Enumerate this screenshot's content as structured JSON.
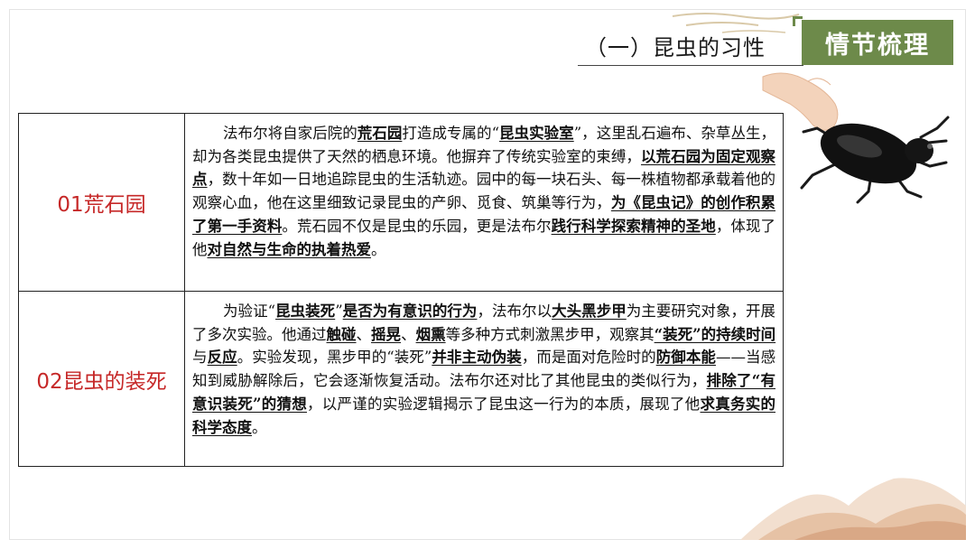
{
  "header": {
    "section_title": "（一）昆虫的习性",
    "badge": "情节梳理"
  },
  "rows": [
    {
      "label": "01荒石园",
      "segments": [
        {
          "t": "法布尔将自家后院的",
          "u": false
        },
        {
          "t": "荒石园",
          "u": true
        },
        {
          "t": "打造成专属的“",
          "u": false
        },
        {
          "t": "昆虫实验室",
          "u": true
        },
        {
          "t": "”，这里乱石遍布、杂草丛生，却为各类昆虫提供了天然的栖息环境。他摒弃了传统实验室的束缚，",
          "u": false
        },
        {
          "t": "以荒石园为固定观察点",
          "u": true
        },
        {
          "t": "，数十年如一日地追踪昆虫的生活轨迹。园中的每一块石头、每一株植物都承载着他的观察心血，他在这里细致记录昆虫的产卵、觅食、筑巢等行为，",
          "u": false
        },
        {
          "t": "为《昆虫记》的创作积累了第一手资料",
          "u": true
        },
        {
          "t": "。荒石园不仅是昆虫的乐园，更是法布尔",
          "u": false
        },
        {
          "t": "践行科学探索精神的圣地",
          "u": true
        },
        {
          "t": "，体现了他",
          "u": false
        },
        {
          "t": "对自然与生命的执着热爱",
          "u": true
        },
        {
          "t": "。",
          "u": false
        }
      ]
    },
    {
      "label": "02昆虫的装死",
      "segments": [
        {
          "t": "为验证“",
          "u": false
        },
        {
          "t": "昆虫装死",
          "u": true
        },
        {
          "t": "”",
          "u": false
        },
        {
          "t": "是否为有意识的行为",
          "u": true
        },
        {
          "t": "，法布尔以",
          "u": false
        },
        {
          "t": "大头黑步甲",
          "u": true
        },
        {
          "t": "为主要研究对象，开展了多次实验。他通过",
          "u": false
        },
        {
          "t": "触碰",
          "u": true
        },
        {
          "t": "、",
          "u": false
        },
        {
          "t": "摇晃",
          "u": true
        },
        {
          "t": "、",
          "u": false
        },
        {
          "t": "烟熏",
          "u": true
        },
        {
          "t": "等多种方式刺激黑步甲，观察其",
          "u": false
        },
        {
          "t": "“装死”的持续时间",
          "u": true
        },
        {
          "t": "与",
          "u": false
        },
        {
          "t": "反应",
          "u": true
        },
        {
          "t": "。实验发现，黑步甲的“装死”",
          "u": false
        },
        {
          "t": "并非主动伪装",
          "u": true
        },
        {
          "t": "，而是面对危险时的",
          "u": false
        },
        {
          "t": "防御本能",
          "u": true
        },
        {
          "t": "——当感知到威胁解除后，它会逐渐恢复活动。法布尔还对比了其他昆虫的类似行为，",
          "u": false
        },
        {
          "t": "排除了“有意识装死”的猜想",
          "u": true
        },
        {
          "t": "，以严谨的实验逻辑揭示了昆虫这一行为的本质，展现了他",
          "u": false
        },
        {
          "t": "求真务实的科学态度",
          "u": true
        },
        {
          "t": "。",
          "u": false
        }
      ]
    }
  ],
  "decorations": {
    "icons": [
      "beetle-icon",
      "hand-icon",
      "cloud-pattern-icon",
      "mountain-icon"
    ],
    "accent_color": "#6d8a4a",
    "label_color": "#c62828"
  }
}
